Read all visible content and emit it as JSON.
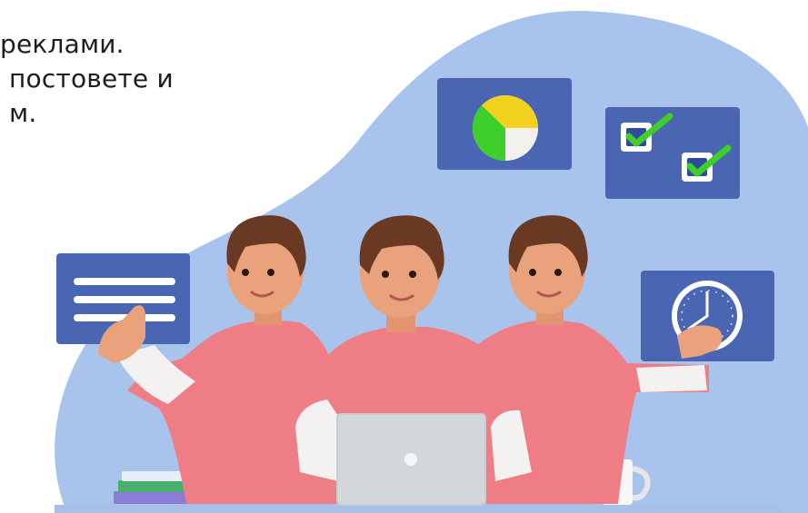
{
  "intro_text": {
    "line1": "реклами.",
    "line2": "постовете и",
    "line3": "м."
  },
  "colors": {
    "blob": "#a9c4ec",
    "panel": "#4a66b2",
    "shirt": "#ee7d86",
    "sleeve": "#f4f2f0",
    "hair": "#6a3924",
    "skin": "#e9a27c",
    "laptop": "#c9ccd1",
    "check_green": "#3fcf2a",
    "pie_yellow": "#f2d21f"
  },
  "icons": {
    "text_panel": "text-lines-icon",
    "pie_panel": "pie-chart-icon",
    "checkbox_panel": "checkbox-checked-icon",
    "clock_panel": "clock-icon"
  }
}
